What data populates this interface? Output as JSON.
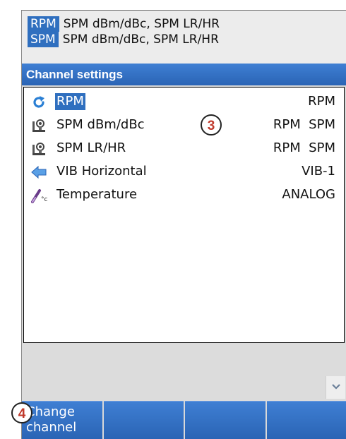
{
  "header": {
    "lines": [
      {
        "tag": "RPM",
        "text": "SPM dBm/dBc, SPM LR/HR"
      },
      {
        "tag": "SPM",
        "text": "SPM dBm/dBc, SPM LR/HR"
      }
    ]
  },
  "title": "Channel settings",
  "channels": [
    {
      "name": "RPM",
      "value": "RPM",
      "icon": "refresh-icon",
      "selected": true
    },
    {
      "name": "SPM dBm/dBc",
      "value": "RPM  SPM",
      "icon": "spm-sensor-icon"
    },
    {
      "name": "SPM LR/HR",
      "value": "RPM  SPM",
      "icon": "spm-sensor-icon"
    },
    {
      "name": "VIB Horizontal",
      "value": "VIB-1",
      "icon": "arrow-left-icon"
    },
    {
      "name": "Temperature",
      "value": "ANALOG",
      "icon": "temperature-probe-icon"
    }
  ],
  "callouts": {
    "list": "3",
    "button": "4"
  },
  "softkeys": {
    "b1": [
      "Change",
      "channel"
    ],
    "b2": "",
    "b3": "",
    "b4": ""
  },
  "colors": {
    "accent": "#2f6fbf",
    "callout_text": "#c0392b"
  }
}
